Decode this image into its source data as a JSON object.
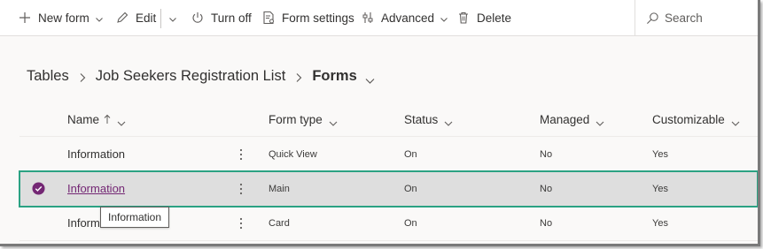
{
  "command_bar": {
    "new_form": "New form",
    "edit": "Edit",
    "turn_off": "Turn off",
    "form_settings": "Form settings",
    "advanced": "Advanced",
    "delete": "Delete",
    "search_placeholder": "Search"
  },
  "breadcrumb": {
    "tables": "Tables",
    "table_name": "Job Seekers Registration List",
    "current": "Forms"
  },
  "grid": {
    "headers": {
      "name": "Name",
      "form_type": "Form type",
      "status": "Status",
      "managed": "Managed",
      "customizable": "Customizable"
    },
    "rows": [
      {
        "name": "Information",
        "form_type": "Quick View",
        "status": "On",
        "managed": "No",
        "customizable": "Yes",
        "selected": false
      },
      {
        "name": "Information",
        "form_type": "Main",
        "status": "On",
        "managed": "No",
        "customizable": "Yes",
        "selected": true
      },
      {
        "name": "Information",
        "form_type": "Card",
        "status": "On",
        "managed": "No",
        "customizable": "Yes",
        "selected": false
      }
    ]
  },
  "tooltip": {
    "text": "Information"
  },
  "colors": {
    "accent_purple": "#742774",
    "selection_outline": "#2ba283",
    "selected_row_bg": "#dedede"
  },
  "icons": {
    "new_form": "plus-icon",
    "edit": "pencil-icon",
    "turn_off": "power-icon",
    "form_settings": "form-settings-icon",
    "advanced": "advanced-icon",
    "delete": "trash-icon",
    "search": "search-icon",
    "row_check": "check-circle-icon",
    "row_more": "more-vertical-icon"
  }
}
